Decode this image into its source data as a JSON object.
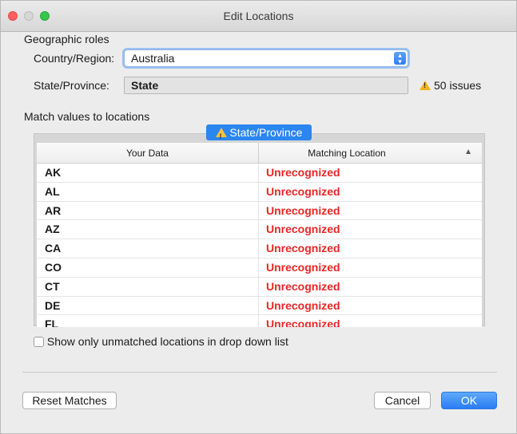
{
  "window": {
    "title": "Edit Locations"
  },
  "roles": {
    "heading": "Geographic roles",
    "country_label": "Country/Region:",
    "country_value": "Australia",
    "state_label": "State/Province:",
    "state_value": "State",
    "issues_text": "50 issues"
  },
  "match": {
    "heading": "Match values to locations",
    "tab_label": "State/Province",
    "columns": {
      "your_data": "Your Data",
      "matching": "Matching Location"
    },
    "rows": [
      {
        "data": "AK",
        "match": "Unrecognized"
      },
      {
        "data": "AL",
        "match": "Unrecognized"
      },
      {
        "data": "AR",
        "match": "Unrecognized"
      },
      {
        "data": "AZ",
        "match": "Unrecognized"
      },
      {
        "data": "CA",
        "match": "Unrecognized"
      },
      {
        "data": "CO",
        "match": "Unrecognized"
      },
      {
        "data": "CT",
        "match": "Unrecognized"
      },
      {
        "data": "DE",
        "match": "Unrecognized"
      },
      {
        "data": "FL",
        "match": "Unrecognized"
      }
    ]
  },
  "options": {
    "show_unmatched_label": "Show only unmatched locations in drop down list"
  },
  "buttons": {
    "reset": "Reset Matches",
    "cancel": "Cancel",
    "ok": "OK"
  },
  "colors": {
    "accent": "#2b86f0",
    "unrecognized": "#ee2424",
    "warning": "#f2b31c"
  }
}
